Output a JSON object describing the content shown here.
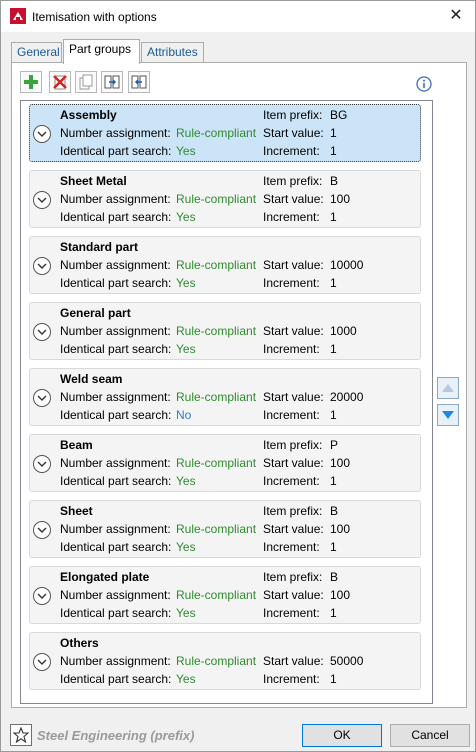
{
  "window": {
    "title": "Itemisation with options"
  },
  "tabs": [
    {
      "label": "General"
    },
    {
      "label": "Part groups"
    },
    {
      "label": "Attributes"
    }
  ],
  "toolbar": {
    "buttons": [
      "add-icon",
      "delete-icon",
      "copy-icon",
      "export-icon",
      "import-icon"
    ]
  },
  "labels": {
    "number_assignment": "Number assignment:",
    "identical_part_search": "Identical part search:",
    "item_prefix": "Item prefix:",
    "start_value": "Start value:",
    "increment": "Increment:"
  },
  "groups": [
    {
      "name": "Assembly",
      "number_assignment": "Rule-compliant",
      "identical_part_search": "Yes",
      "item_prefix": "BG",
      "start_value": "1",
      "increment": "1"
    },
    {
      "name": "Sheet Metal",
      "number_assignment": "Rule-compliant",
      "identical_part_search": "Yes",
      "item_prefix": "B",
      "start_value": "100",
      "increment": "1"
    },
    {
      "name": "Standard part",
      "number_assignment": "Rule-compliant",
      "identical_part_search": "Yes",
      "start_value": "10000",
      "increment": "1"
    },
    {
      "name": "General part",
      "number_assignment": "Rule-compliant",
      "identical_part_search": "Yes",
      "start_value": "1000",
      "increment": "1"
    },
    {
      "name": "Weld seam",
      "number_assignment": "Rule-compliant",
      "identical_part_search": "No",
      "start_value": "20000",
      "increment": "1"
    },
    {
      "name": "Beam",
      "number_assignment": "Rule-compliant",
      "identical_part_search": "Yes",
      "item_prefix": "P",
      "start_value": "100",
      "increment": "1"
    },
    {
      "name": "Sheet",
      "number_assignment": "Rule-compliant",
      "identical_part_search": "Yes",
      "item_prefix": "B",
      "start_value": "100",
      "increment": "1"
    },
    {
      "name": "Elongated plate",
      "number_assignment": "Rule-compliant",
      "identical_part_search": "Yes",
      "item_prefix": "B",
      "start_value": "100",
      "increment": "1"
    },
    {
      "name": "Others",
      "number_assignment": "Rule-compliant",
      "identical_part_search": "Yes",
      "start_value": "50000",
      "increment": "1"
    }
  ],
  "footer": {
    "configuration": "Steel Engineering (prefix)",
    "ok_label": "OK",
    "cancel_label": "Cancel"
  },
  "colors": {
    "green_value": "#2e8b2e",
    "blue_value": "#2f7bd0",
    "selection": "#cce4f7"
  }
}
